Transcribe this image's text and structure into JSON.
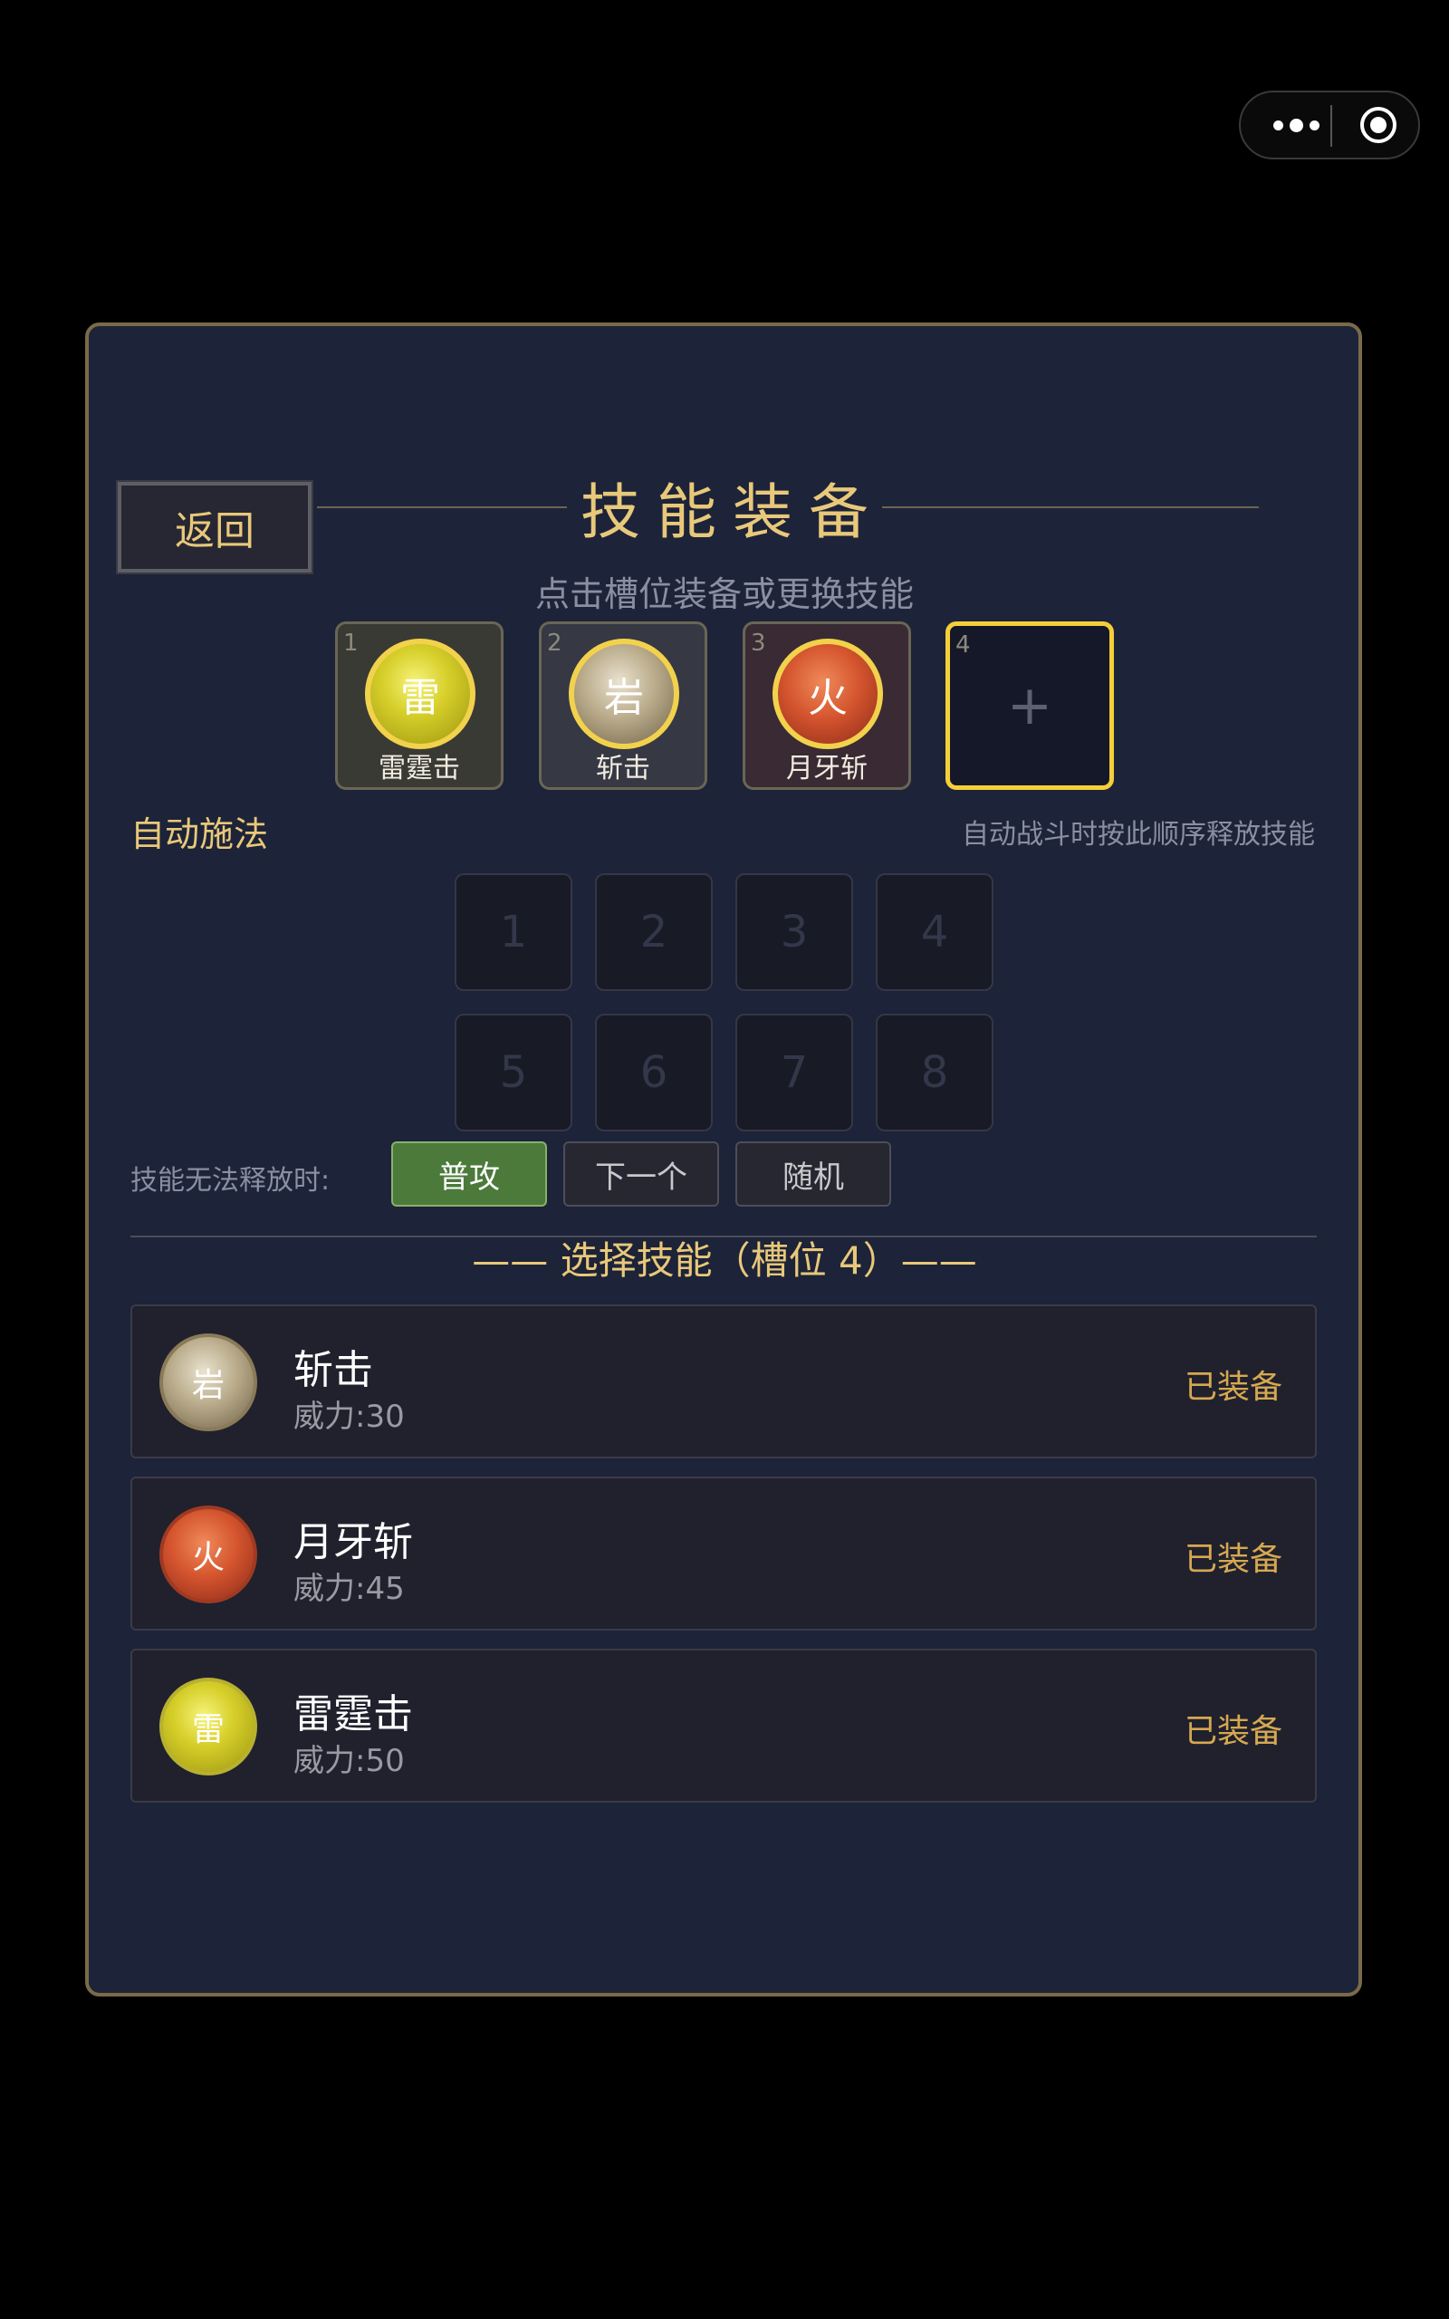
{
  "header": {
    "back_label": "返回",
    "title": "技能装备",
    "subtitle": "点击槽位装备或更换技能"
  },
  "slots": [
    {
      "num": "1",
      "glyph": "雷",
      "label": "雷霆击",
      "element": "thunder"
    },
    {
      "num": "2",
      "glyph": "岩",
      "label": "斩击",
      "element": "rock"
    },
    {
      "num": "3",
      "glyph": "火",
      "label": "月牙斩",
      "element": "fire"
    },
    {
      "num": "4",
      "glyph": "+",
      "label": "",
      "element": "empty"
    }
  ],
  "auto_cast": {
    "label": "自动施法",
    "hint": "自动战斗时按此顺序释放技能",
    "cells": [
      "1",
      "2",
      "3",
      "4",
      "5",
      "6",
      "7",
      "8"
    ]
  },
  "fallback": {
    "label": "技能无法释放时:",
    "options": [
      "普攻",
      "下一个",
      "随机"
    ],
    "selected": "普攻"
  },
  "skill_list": {
    "title": "—— 选择技能（槽位 4）——",
    "items": [
      {
        "glyph": "岩",
        "name": "斩击",
        "power": "威力:30",
        "status": "已装备",
        "element": "rock"
      },
      {
        "glyph": "火",
        "name": "月牙斩",
        "power": "威力:45",
        "status": "已装备",
        "element": "fire"
      },
      {
        "glyph": "雷",
        "name": "雷霆击",
        "power": "威力:50",
        "status": "已装备",
        "element": "thunder"
      }
    ]
  },
  "colors": {
    "background": "#000000",
    "panel": "#1d2338",
    "panel_border": "#7a6a48",
    "gold_text": "#e8c87a",
    "active_option": "#4b7a3a",
    "empty_slot_border": "#f5cf3a",
    "equipped_status": "#d6a851"
  },
  "icons": [
    "more-dots-icon",
    "target-icon",
    "plus-icon"
  ]
}
